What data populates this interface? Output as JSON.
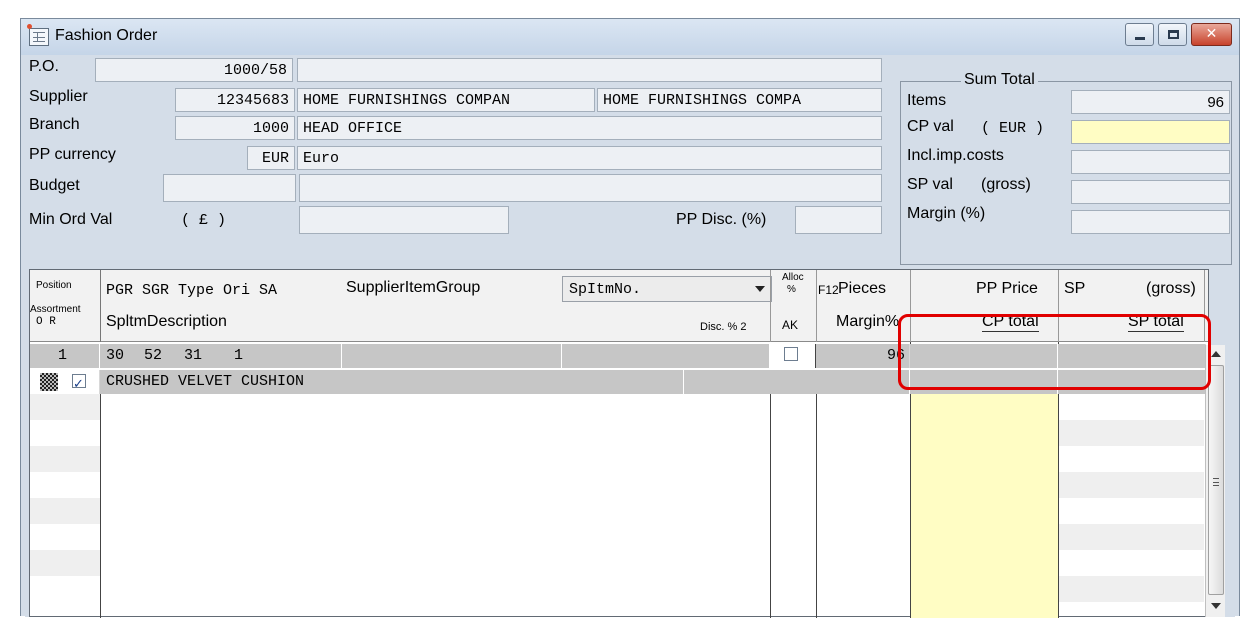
{
  "window": {
    "title": "Fashion Order"
  },
  "header": {
    "po_label": "P.O.",
    "po_value": "1000/58",
    "supplier_label": "Supplier",
    "supplier_code": "12345683",
    "supplier_name1": "HOME FURNISHINGS COMPAN",
    "supplier_name2": "HOME FURNISHINGS COMPA",
    "branch_label": "Branch",
    "branch_code": "1000",
    "branch_name": "HEAD OFFICE",
    "currency_label": "PP currency",
    "currency_code": "EUR",
    "currency_name": "Euro",
    "budget_label": "Budget",
    "min_ord_label": "Min Ord Val",
    "min_ord_unit": "( £ )",
    "pp_disc_label": "PP Disc. (%)"
  },
  "sum_total": {
    "title": "Sum Total",
    "items_label": "Items",
    "items_value": "96",
    "cp_val_label": "CP val",
    "cp_val_unit": "( EUR )",
    "incl_label": "Incl.imp.costs",
    "sp_val_label": "SP val",
    "sp_val_unit": "(gross)",
    "margin_label": "Margin (%)"
  },
  "grid": {
    "h_position": "Position",
    "h_assortment": "Assortment",
    "h_or": "O  R",
    "h_codes": "PGR SGR Type Ori  SA",
    "h_supplier_item_group": "SupplierItemGroup",
    "h_combo": "SpItmNo.",
    "h_description": "SpltmDescription",
    "h_disc2": "Disc. % 2",
    "h_alloc": "Alloc",
    "h_pct": "%",
    "h_ak": "AK",
    "h_f12": "F12",
    "h_pieces": "Pieces",
    "h_marginpct": "Margin%",
    "h_pp_price": "PP Price",
    "h_cp_total": "CP total",
    "h_sp": "SP",
    "h_gross": "(gross)",
    "h_sp_total": "SP total",
    "row1": {
      "position": "1",
      "pgr": "30",
      "sgr": "52",
      "type": "31",
      "ori": "1",
      "pieces": "96",
      "description": "CRUSHED VELVET CUSHION"
    }
  }
}
